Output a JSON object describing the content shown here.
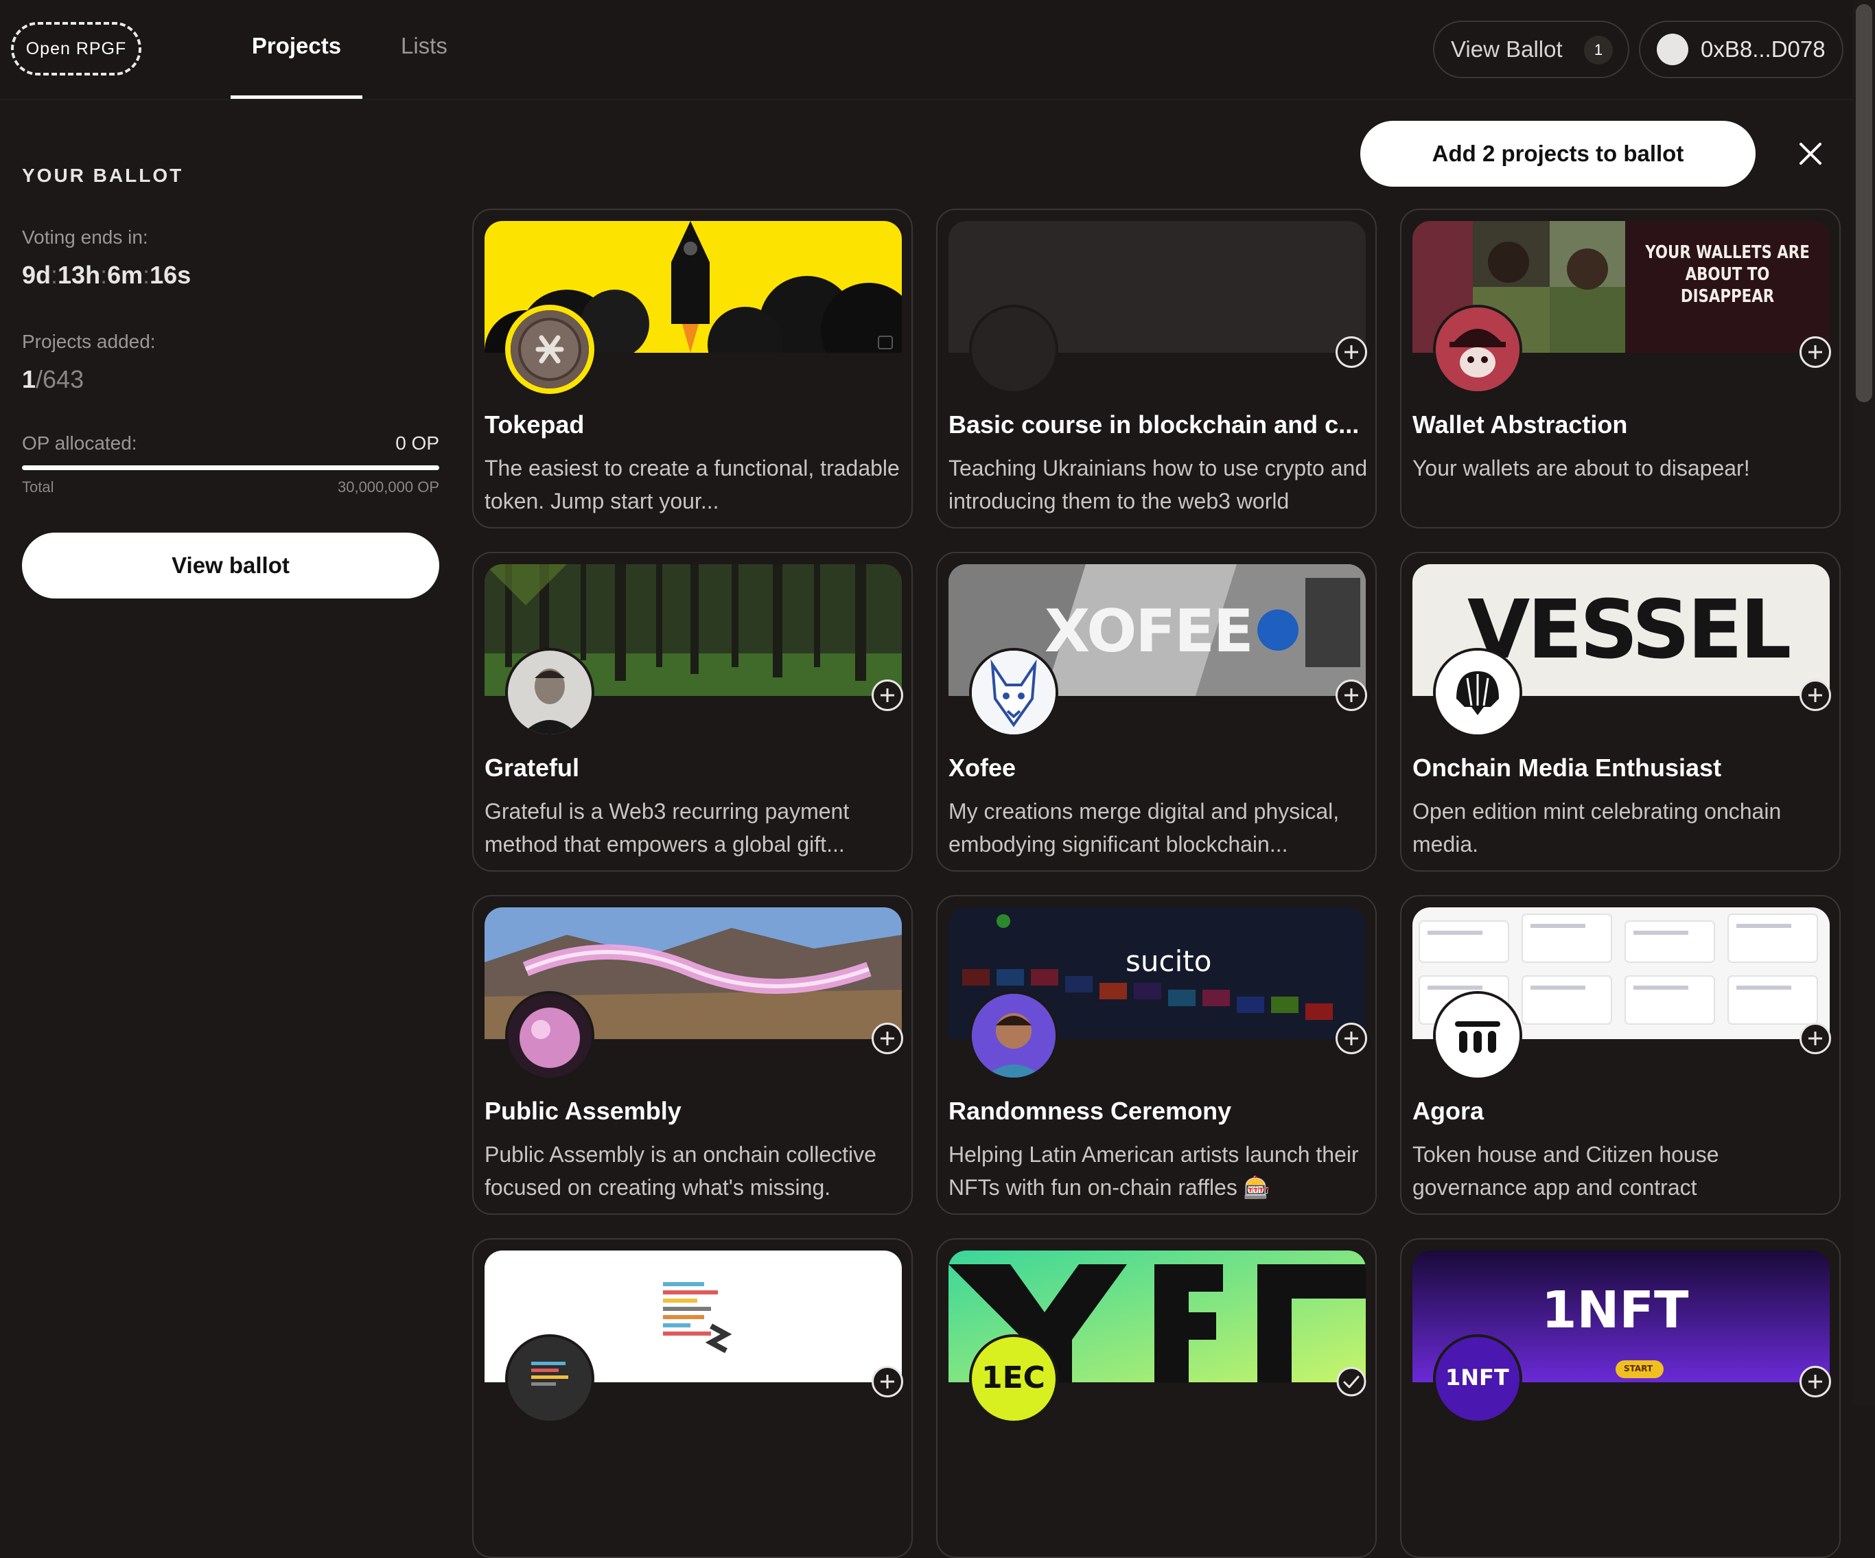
{
  "header": {
    "logo": "Open RPGF",
    "tabs": [
      {
        "label": "Projects",
        "active": true
      },
      {
        "label": "Lists",
        "active": false
      }
    ],
    "view_ballot_label": "View Ballot",
    "ballot_count": "1",
    "wallet": "0xB8...D078"
  },
  "sidebar": {
    "title": "YOUR BALLOT",
    "voting_label": "Voting ends in:",
    "voting": {
      "d": "9d",
      "h": "13h",
      "m": "6m",
      "s": "16s"
    },
    "projects_label": "Projects added:",
    "projects_added": "1",
    "projects_total": "/643",
    "op_label": "OP allocated:",
    "op_value": "0 OP",
    "op_allocated_fraction": 0,
    "total_label": "Total",
    "total_value": "30,000,000 OP",
    "view_ballot_button": "View ballot"
  },
  "actions": {
    "add_button": "Add 2 projects to ballot"
  },
  "cover_texts": {
    "wallet_headline_1": "YOUR WALLETS ARE",
    "wallet_headline_2": "ABOUT TO",
    "wallet_headline_3": "DISAPPEAR",
    "xofee": "XOFEE",
    "vessel": "VESSEL",
    "sucito": "sucito",
    "onenft": "1NFT",
    "onenft_start": "START",
    "onenft_avatar": "1NFT",
    "onetec_avatar": "1EC"
  },
  "projects": [
    {
      "title": "Tokepad",
      "description": "The easiest to create a functional, tradable token. Jump start your..."
    },
    {
      "title": "Basic course in blockchain and c...",
      "description": "Teaching Ukrainians how to use crypto and introducing them to the web3 world"
    },
    {
      "title": "Wallet Abstraction",
      "description": "Your wallets are about to disapear!"
    },
    {
      "title": "Grateful",
      "description": "Grateful is a Web3 recurring payment method that empowers a global gift..."
    },
    {
      "title": "Xofee",
      "description": "My creations merge digital and physical, embodying significant blockchain..."
    },
    {
      "title": "Onchain Media Enthusiast",
      "description": "Open edition mint celebrating onchain media."
    },
    {
      "title": "Public Assembly",
      "description": "Public Assembly is an onchain collective focused on creating what's missing."
    },
    {
      "title": "Randomness Ceremony",
      "description": "Helping Latin American artists launch their NFTs with fun on-chain raffles 🎰"
    },
    {
      "title": "Agora",
      "description": "Token house and Citizen house governance app and contract"
    }
  ],
  "colors": {
    "background": "#1b1817",
    "accent": "#ffffff",
    "card_border": "#3a3634"
  }
}
